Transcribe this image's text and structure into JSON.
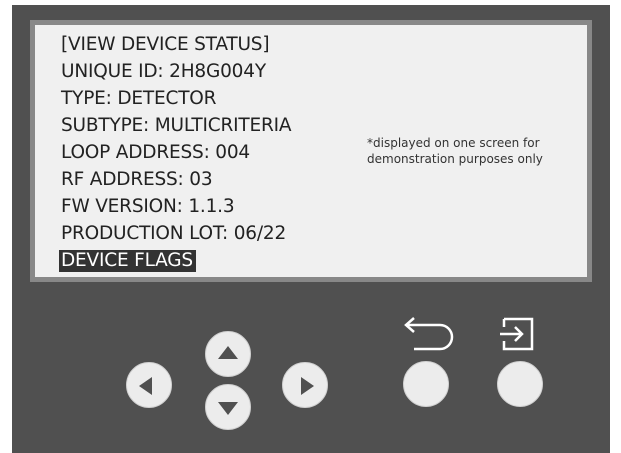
{
  "screen": {
    "lines": [
      "[VIEW DEVICE STATUS]",
      "UNIQUE ID: 2H8G004Y",
      "TYPE: DETECTOR",
      "SUBTYPE: MULTICRITERIA",
      "LOOP ADDRESS: 004",
      "RF ADDRESS: 03",
      "FW VERSION: 1.1.3",
      "PRODUCTION LOT: 06/22"
    ],
    "selected_item": "DEVICE FLAGS",
    "note": "*displayed on one screen for\ndemonstration purposes only"
  },
  "controls": {
    "left_icon": "triangle-left-icon",
    "up_icon": "triangle-up-icon",
    "down_icon": "triangle-down-icon",
    "right_icon": "triangle-right-icon",
    "back_icon": "return-arrow-icon",
    "enter_icon": "enter-icon"
  },
  "colors": {
    "panel": "#505050",
    "screen": "#f0f0f0",
    "screen_border": "#888888",
    "selection_bg": "#333333",
    "button": "#ececec",
    "icon_light": "#ffffff"
  }
}
